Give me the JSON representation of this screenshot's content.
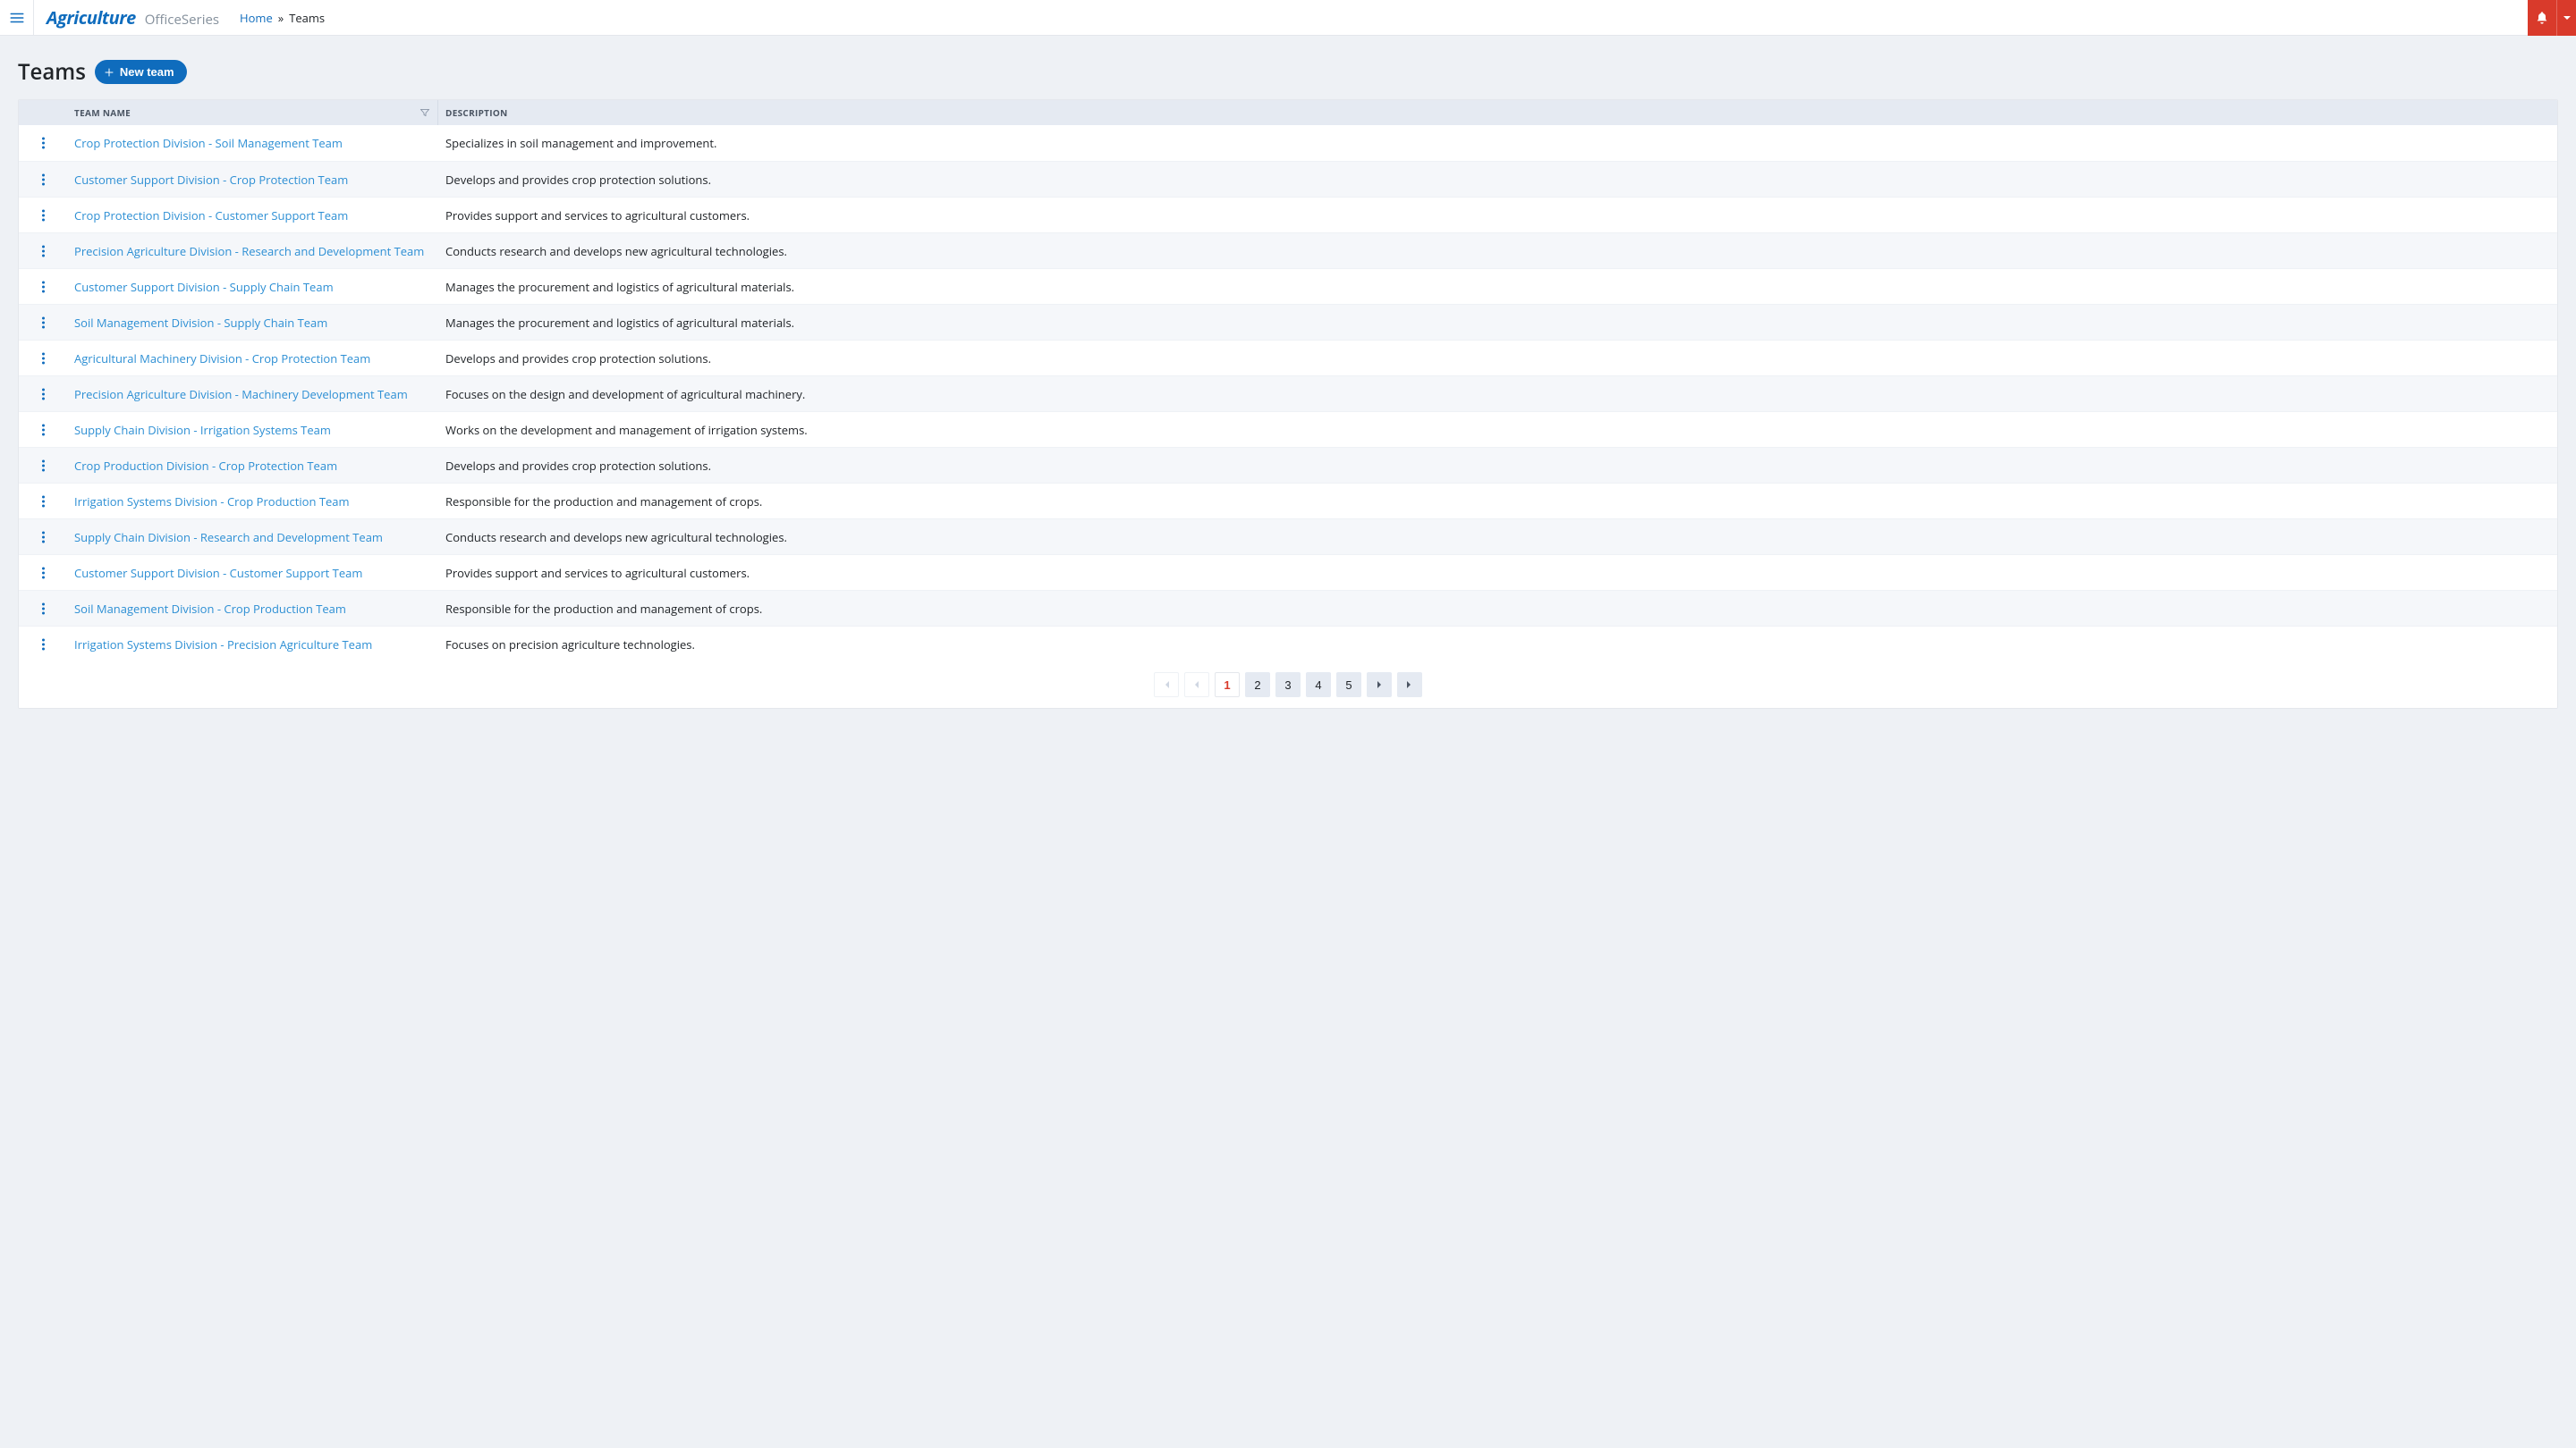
{
  "header": {
    "app_name": "Agriculture",
    "suite_name": "OfficeSeries",
    "breadcrumb": {
      "home": "Home",
      "sep": "»",
      "current": "Teams"
    }
  },
  "page": {
    "title": "Teams",
    "new_button": "New team"
  },
  "table": {
    "columns": {
      "name": "TEAM NAME",
      "description": "DESCRIPTION"
    },
    "rows": [
      {
        "name": "Crop Protection Division - Soil Management Team",
        "description": "Specializes in soil management and improvement."
      },
      {
        "name": "Customer Support Division - Crop Protection Team",
        "description": "Develops and provides crop protection solutions."
      },
      {
        "name": "Crop Protection Division - Customer Support Team",
        "description": "Provides support and services to agricultural customers."
      },
      {
        "name": "Precision Agriculture Division - Research and Development Team",
        "description": "Conducts research and develops new agricultural technologies."
      },
      {
        "name": "Customer Support Division - Supply Chain Team",
        "description": "Manages the procurement and logistics of agricultural materials."
      },
      {
        "name": "Soil Management Division - Supply Chain Team",
        "description": "Manages the procurement and logistics of agricultural materials."
      },
      {
        "name": "Agricultural Machinery Division - Crop Protection Team",
        "description": "Develops and provides crop protection solutions."
      },
      {
        "name": "Precision Agriculture Division - Machinery Development Team",
        "description": "Focuses on the design and development of agricultural machinery."
      },
      {
        "name": "Supply Chain Division - Irrigation Systems Team",
        "description": "Works on the development and management of irrigation systems."
      },
      {
        "name": "Crop Production Division - Crop Protection Team",
        "description": "Develops and provides crop protection solutions."
      },
      {
        "name": "Irrigation Systems Division - Crop Production Team",
        "description": "Responsible for the production and management of crops."
      },
      {
        "name": "Supply Chain Division - Research and Development Team",
        "description": "Conducts research and develops new agricultural technologies."
      },
      {
        "name": "Customer Support Division - Customer Support Team",
        "description": "Provides support and services to agricultural customers."
      },
      {
        "name": "Soil Management Division - Crop Production Team",
        "description": "Responsible for the production and management of crops."
      },
      {
        "name": "Irrigation Systems Division - Precision Agriculture Team",
        "description": "Focuses on precision agriculture technologies."
      }
    ]
  },
  "pagination": {
    "pages": [
      "1",
      "2",
      "3",
      "4",
      "5"
    ],
    "current": "1"
  }
}
